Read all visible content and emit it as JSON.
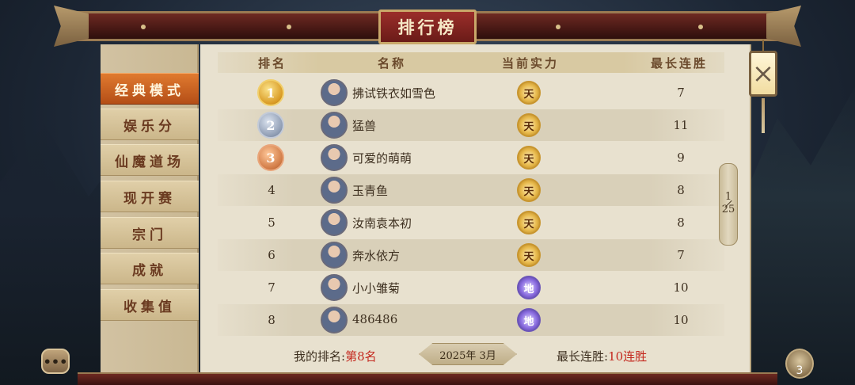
{
  "title": "排行榜",
  "sidebar": {
    "items": [
      {
        "label": "经典模式",
        "active": true
      },
      {
        "label": "娱乐分",
        "active": false
      },
      {
        "label": "仙魔道场",
        "active": false
      },
      {
        "label": "现开赛",
        "active": false
      },
      {
        "label": "宗门",
        "active": false
      },
      {
        "label": "成就",
        "active": false
      },
      {
        "label": "收集值",
        "active": false
      }
    ]
  },
  "table": {
    "headers": {
      "rank": "排名",
      "name": "名称",
      "power": "当前实力",
      "streak": "最长连胜"
    },
    "rows": [
      {
        "rank": "1",
        "name": "拂试铁衣如雪色",
        "power": "天",
        "streak": "7"
      },
      {
        "rank": "2",
        "name": "猛兽",
        "power": "天",
        "streak": "11"
      },
      {
        "rank": "3",
        "name": "可爱的萌萌",
        "power": "天",
        "streak": "9"
      },
      {
        "rank": "4",
        "name": "玉青鱼",
        "power": "天",
        "streak": "8"
      },
      {
        "rank": "5",
        "name": "汝南袁本初",
        "power": "天",
        "streak": "8"
      },
      {
        "rank": "6",
        "name": "奔水依方",
        "power": "天",
        "streak": "7"
      },
      {
        "rank": "7",
        "name": "小小雏菊",
        "power": "地",
        "streak": "10"
      },
      {
        "rank": "8",
        "name": "486486",
        "power": "地",
        "streak": "10"
      }
    ]
  },
  "footer": {
    "my_rank_label": "我的排名:",
    "my_rank_value": "第8名",
    "date": "2025年 3月",
    "streak_label": "最长连胜:",
    "streak_value": "10连胜"
  },
  "scroll": {
    "current": "1",
    "total": "25"
  },
  "close_icon": "×",
  "chat_icon": "•••",
  "gift_count": "3",
  "colors": {
    "accent_red": "#c4281e",
    "active_tab": "#d0641f",
    "tian_badge": "#e7b84a",
    "di_badge": "#8a6de0"
  }
}
